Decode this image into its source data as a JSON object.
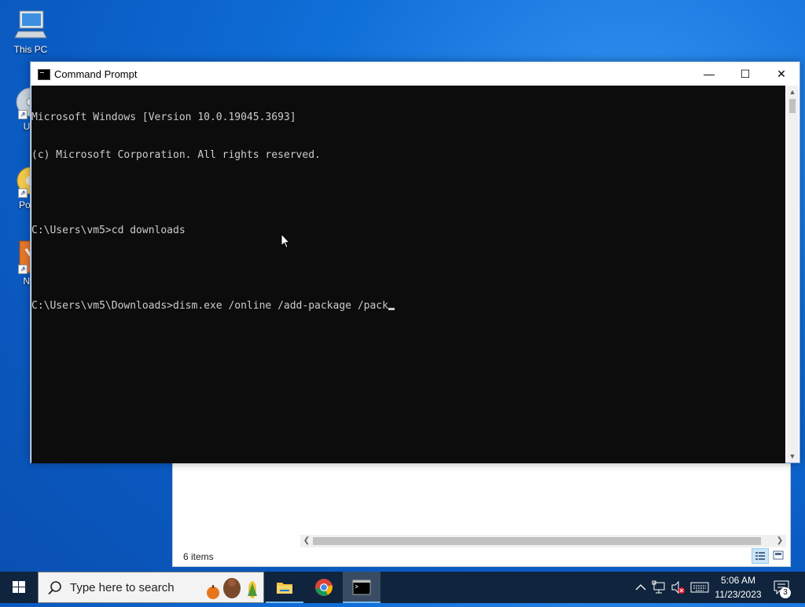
{
  "desktop": {
    "icons": [
      {
        "label": "This PC"
      },
      {
        "label": "Ultr"
      },
      {
        "label": "Powe"
      },
      {
        "label": "NTI"
      }
    ]
  },
  "cmd_window": {
    "title": "Command Prompt",
    "minimize": "—",
    "maximize": "☐",
    "close": "✕",
    "lines": [
      "Microsoft Windows [Version 10.0.19045.3693]",
      "(c) Microsoft Corporation. All rights reserved.",
      "",
      "C:\\Users\\vm5>cd downloads",
      "",
      "C:\\Users\\vm5\\Downloads>dism.exe /online /add-package /pack"
    ]
  },
  "explorer_window": {
    "status": "6 items"
  },
  "taskbar": {
    "search_placeholder": "Type here to search",
    "apps": [
      {
        "name": "file-explorer"
      },
      {
        "name": "chrome"
      },
      {
        "name": "command-prompt",
        "active": true
      }
    ],
    "clock": {
      "time": "5:06 AM",
      "date": "11/23/2023"
    },
    "notifications_count": "3"
  },
  "colors": {
    "console_bg": "#0c0c0c",
    "console_fg": "#cccccc",
    "taskbar_bg": "#10243d",
    "accent": "#76b9ed"
  }
}
